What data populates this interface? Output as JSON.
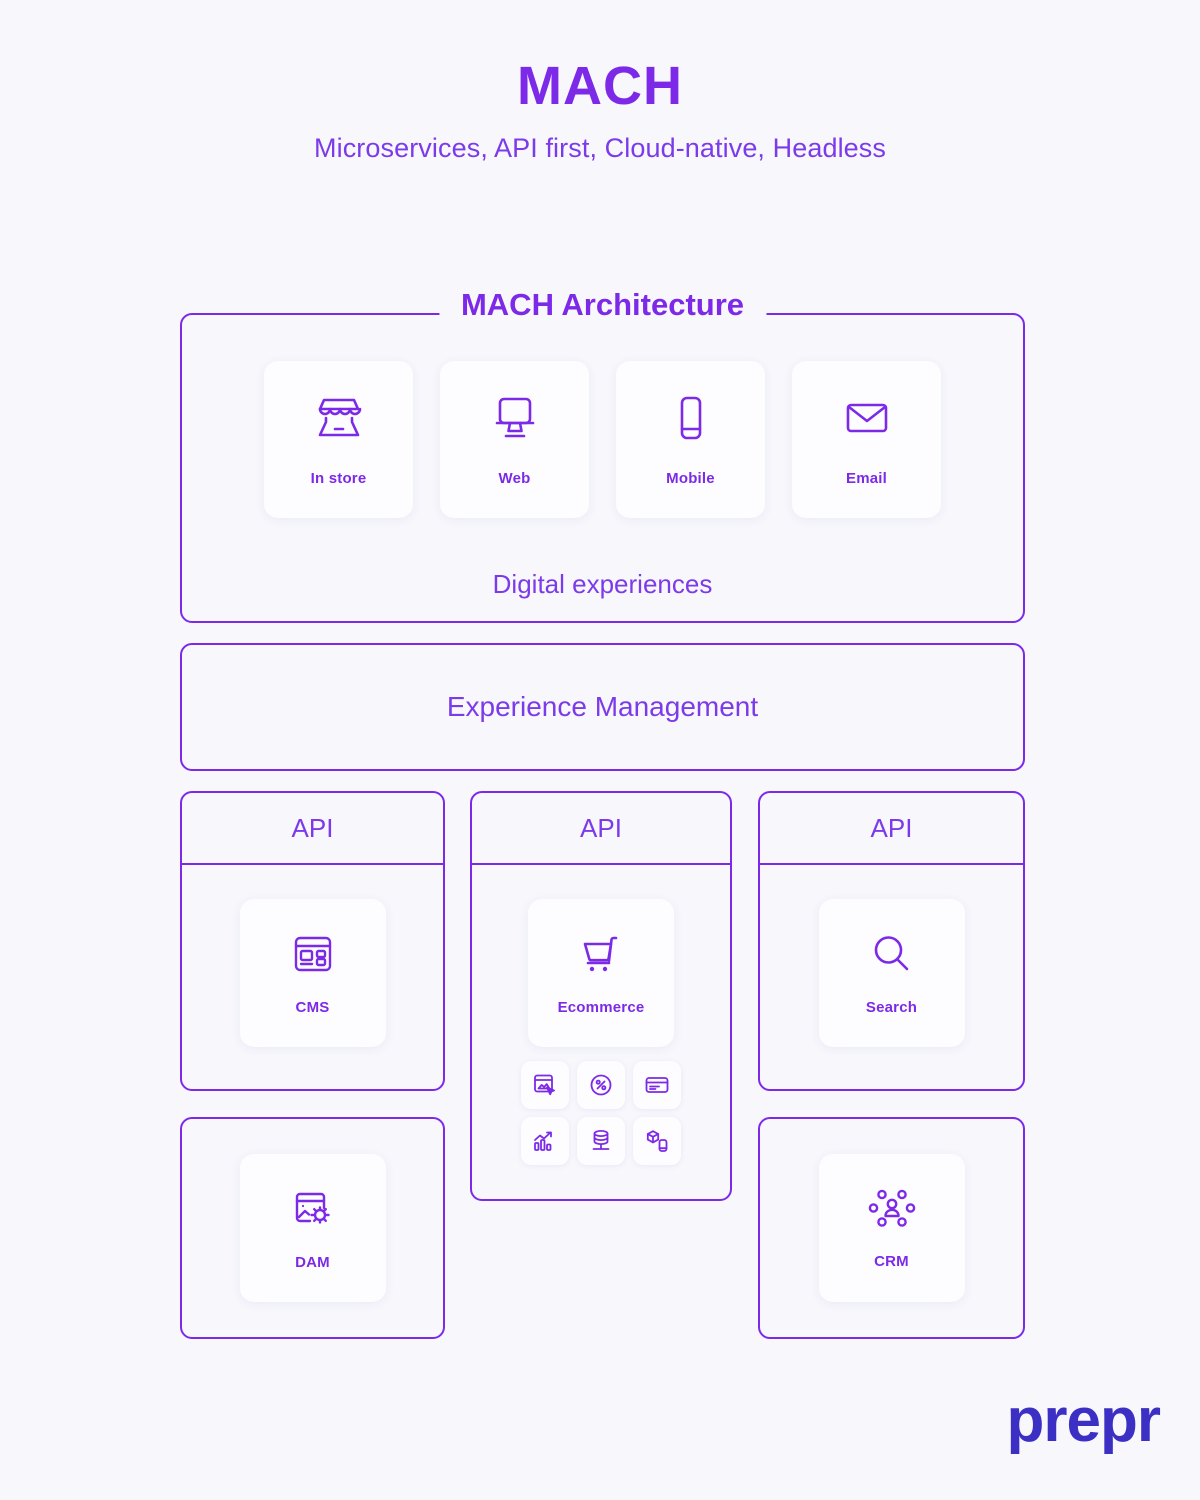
{
  "hero": {
    "title": "MACH",
    "subtitle": "Microservices, API first, Cloud-native, Headless"
  },
  "architecture": {
    "legend": "MACH Architecture",
    "caption": "Digital experiences",
    "channels": [
      {
        "label": "In store",
        "icon": "storefront-icon"
      },
      {
        "label": "Web",
        "icon": "desktop-monitor-icon"
      },
      {
        "label": "Mobile",
        "icon": "mobile-phone-icon"
      },
      {
        "label": "Email",
        "icon": "envelope-icon"
      }
    ]
  },
  "experience_management": {
    "label": "Experience Management"
  },
  "api_columns": [
    {
      "header": "API",
      "service": {
        "label": "CMS",
        "icon": "browser-layout-icon"
      },
      "lower": {
        "label": "DAM",
        "icon": "image-settings-icon"
      }
    },
    {
      "header": "API",
      "service": {
        "label": "Ecommerce",
        "icon": "shopping-cart-icon"
      },
      "mini_services": [
        {
          "icon": "product-select-icon"
        },
        {
          "icon": "percent-discount-icon"
        },
        {
          "icon": "payment-card-icon"
        },
        {
          "icon": "growth-chart-icon"
        },
        {
          "icon": "database-icon"
        },
        {
          "icon": "pim-device-icon"
        }
      ]
    },
    {
      "header": "API",
      "service": {
        "label": "Search",
        "icon": "magnifier-icon"
      },
      "lower": {
        "label": "CRM",
        "icon": "people-network-icon"
      }
    }
  ],
  "brand": {
    "logo_text": "prepr"
  },
  "colors": {
    "accent_purple": "#7c2ae8",
    "text_purple": "#7c3bea",
    "background": "#f7f7fc",
    "card_background": "#fdfdff",
    "logo_indigo": "#3c2fc4"
  }
}
